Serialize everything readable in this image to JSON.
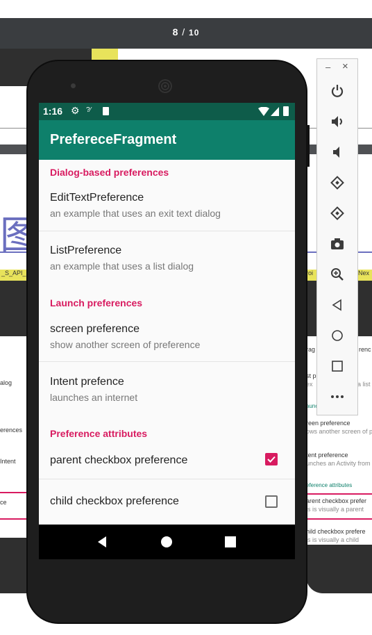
{
  "viewer": {
    "page_current": "8",
    "page_sep": "/",
    "page_total": "10"
  },
  "background": {
    "label_left": "_S_API_",
    "label_right": "Nex",
    "label_right2": "roi",
    "chinese_text": "图",
    "left_items": [
      "alog",
      "erences",
      "Intent",
      "ce"
    ],
    "right_items": [
      {
        "title": "st p",
        "sub": "ex"
      },
      {
        "title": "reen preference",
        "sub": "ows another screen of p"
      },
      {
        "title": "tent preference",
        "sub": "unches an Activity from a"
      },
      {
        "title": "eference attributes",
        "sub": ""
      },
      {
        "title": "arent checkbox prefer",
        "sub": "is is visually a parent"
      },
      {
        "title": "hild checkbox prefere",
        "sub": "is is visually a child"
      }
    ],
    "right_small": "a list",
    "right_header": "rag",
    "right_header2": "renc",
    "right_aunch": "aunch"
  },
  "emulator_panel": {
    "minimize": "–",
    "close": "×",
    "buttons": [
      "power-icon",
      "volume-up-icon",
      "volume-down-icon",
      "rotate-left-icon",
      "rotate-right-icon",
      "camera-icon",
      "zoom-icon",
      "back-icon",
      "home-icon",
      "overview-icon",
      "more-icon"
    ]
  },
  "status_bar": {
    "time": "1:16"
  },
  "app_bar": {
    "title": "PrefereceFragment"
  },
  "preferences": {
    "cat_dialog": "Dialog-based preferences",
    "edittext": {
      "title": "EditTextPreference",
      "summary": "an example that uses an exit text dialog"
    },
    "list": {
      "title": "ListPreference",
      "summary": "an example that uses a list dialog"
    },
    "cat_launch": "Launch preferences",
    "screen": {
      "title": "screen preference",
      "summary": "show another screen of preference"
    },
    "intent": {
      "title": "Intent prefence",
      "summary": "launches an internet"
    },
    "cat_attributes": "Preference attributes",
    "parent_checkbox": {
      "title": "parent checkbox preference",
      "checked": true
    },
    "child_checkbox": {
      "title": "child checkbox preference",
      "checked": false
    }
  },
  "colors": {
    "accent": "#d81b60",
    "primary": "#0e806b",
    "primary_dark": "#0e5c4a"
  }
}
